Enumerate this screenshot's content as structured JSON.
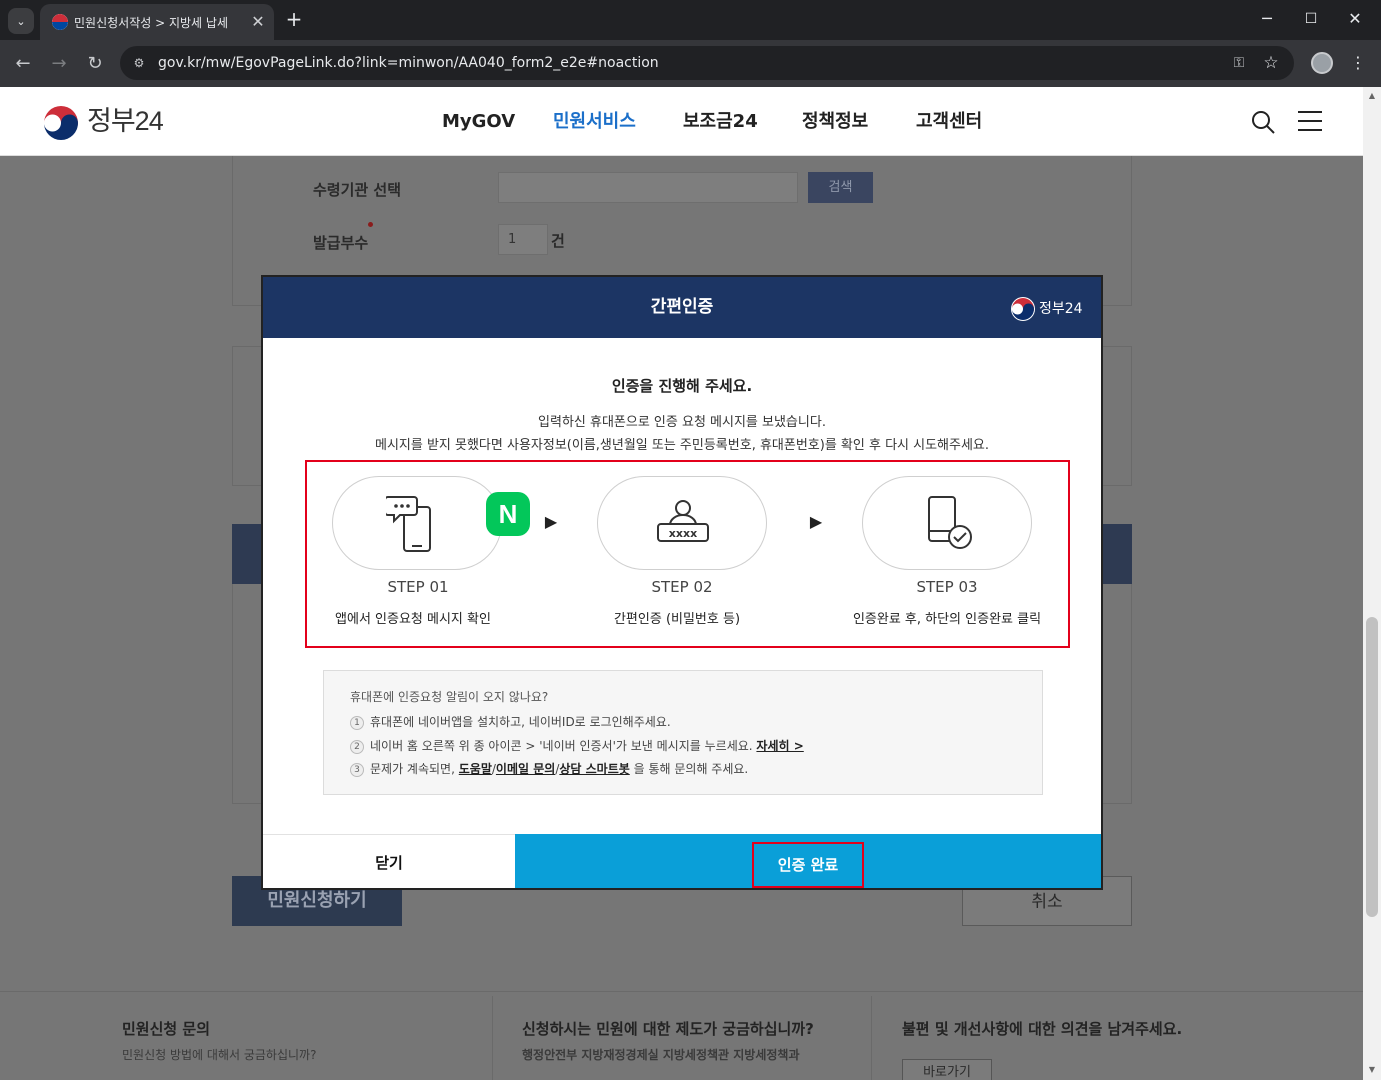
{
  "browser": {
    "tab_title": "민원신청서작성 > 지방세 납세",
    "url": "gov.kr/mw/EgovPageLink.do?link=minwon/AA040_form2_e2e#noaction",
    "new_tab_glyph": "+",
    "close_glyph": "✕"
  },
  "site": {
    "logo_text": "정부24",
    "nav": [
      {
        "label": "MyGOV"
      },
      {
        "label": "민원서비스"
      },
      {
        "label": "보조금24"
      },
      {
        "label": "정책정보"
      },
      {
        "label": "고객센터"
      }
    ],
    "accent_color": "#1b6fc9"
  },
  "form": {
    "agency_label": "수령기관 선택",
    "search_button": "검색",
    "copies_label": "발급부수",
    "copies_value": "1",
    "copies_unit": "건",
    "apply_button": "민원신청하기",
    "cancel_button": "취소"
  },
  "footer": {
    "col1_title": "민원신청 문의",
    "col1_desc": "민원신청 방법에 대해서 궁금하십니까?",
    "col2_title": "신청하시는 민원에 대한 제도가 궁금하십니까?",
    "col2_desc": "행정안전부 지방재정경제실 지방세정책관 지방세정책과",
    "col3_title": "불편 및 개선사항에 대한 의견을 남겨주세요.",
    "col3_button": "바로가기"
  },
  "modal": {
    "title": "간편인증",
    "logo_text": "정부24",
    "message_title": "인증을 진행해 주세요.",
    "message_line1": "입력하신 휴대폰으로 인증 요청 메시지를 보냈습니다.",
    "message_line2": "메시지를 받지 못했다면 사용자정보(이름,생년월일 또는 주민등록번호, 휴대폰번호)를 확인 후 다시 시도해주세요.",
    "steps": [
      {
        "no": "STEP 01",
        "desc": "앱에서 인증요청 메시지 확인",
        "icon": "phone-chat-icon"
      },
      {
        "no": "STEP 02",
        "desc": "간편인증 (비밀번호 등)",
        "icon": "user-password-icon"
      },
      {
        "no": "STEP 03",
        "desc": "인증완료 후, 하단의 인증완료 클릭",
        "icon": "phone-check-icon"
      }
    ],
    "naver_badge": "N",
    "help": {
      "title": "휴대폰에 인증요청 알림이 오지 않나요?",
      "row1_num": "1",
      "row1": "휴대폰에 네이버앱을 설치하고, 네이버ID로 로그인해주세요.",
      "row2_num": "2",
      "row2_a": "네이버 홈 오른쪽 위 종 아이콘 > '네이버 인증서'가 보낸 메시지를 누르세요.",
      "row2_link": "자세히 >",
      "row3_num": "3",
      "row3_a": "문제가 계속되면,",
      "row3_link1": "도움말",
      "row3_sep1": "/",
      "row3_link2": "이메일 문의",
      "row3_sep2": "/",
      "row3_link3": "상담 스마트봇",
      "row3_b": "을 통해 문의해 주세요."
    },
    "close_button": "닫기",
    "confirm_button": "인증 완료",
    "confirm_color": "#0a9fd8",
    "highlight_color": "#e3001b"
  }
}
